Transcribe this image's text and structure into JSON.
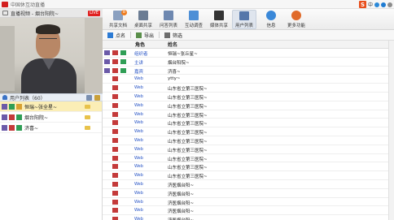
{
  "window": {
    "title": "中国休互动直播"
  },
  "ime": {
    "s_label": "S",
    "mode": "中"
  },
  "video_panel": {
    "title": "直播视频 - 烟台阳院~",
    "live_badge": "LIVE"
  },
  "toolbar": {
    "items": [
      {
        "label": "共享文档",
        "icon": "document-icon",
        "color": "#8aa0c0",
        "badge": "8"
      },
      {
        "label": "桌面共享",
        "icon": "desktop-icon",
        "color": "#6b7c93"
      },
      {
        "label": "问答列表",
        "icon": "qa-icon",
        "color": "#6e88b0"
      },
      {
        "label": "互动调查",
        "icon": "survey-icon",
        "color": "#4d8fd6"
      },
      {
        "label": "媒体共享",
        "icon": "media-icon",
        "color": "#333333"
      },
      {
        "label": "用户列表",
        "icon": "users-icon",
        "color": "#5577aa"
      },
      {
        "label": "信息",
        "icon": "info-icon",
        "color": "#3a88d8"
      },
      {
        "label": "更多功能",
        "icon": "more-icon",
        "color": "#e06a2a"
      }
    ]
  },
  "subbar": {
    "call_label": "点名",
    "export_label": "导出",
    "filter_label": "筛选"
  },
  "table": {
    "col_role": "角色",
    "col_name": "姓名",
    "rows": [
      {
        "type": "pc",
        "role": "组织者",
        "name": "恒瑞~张丘星~"
      },
      {
        "type": "pc",
        "role": "主讲",
        "name": "烟台阳院~"
      },
      {
        "type": "pc",
        "role": "嘉宾",
        "name": "济喜~"
      },
      {
        "type": "web",
        "web": "Web",
        "role": "",
        "name": "ytty~"
      },
      {
        "type": "web",
        "web": "Web",
        "role": "",
        "name": "山东省立第三医院~"
      },
      {
        "type": "web",
        "web": "Web",
        "role": "",
        "name": "山东省立第三医院~"
      },
      {
        "type": "web",
        "web": "Web",
        "role": "",
        "name": "山东省立第三医院~"
      },
      {
        "type": "web",
        "web": "Web",
        "role": "",
        "name": "山东省立第三医院~"
      },
      {
        "type": "web",
        "web": "Web",
        "role": "",
        "name": "山东省立第三医院~"
      },
      {
        "type": "web",
        "web": "Web",
        "role": "",
        "name": "山东省立第三医院~"
      },
      {
        "type": "web",
        "web": "Web",
        "role": "",
        "name": "山东省立第三医院~"
      },
      {
        "type": "web",
        "web": "Web",
        "role": "",
        "name": "山东省立第三医院~"
      },
      {
        "type": "web",
        "web": "Web",
        "role": "",
        "name": "山东省立第三医院~"
      },
      {
        "type": "web",
        "web": "Web",
        "role": "",
        "name": "山东省立第三医院~"
      },
      {
        "type": "web",
        "web": "Web",
        "role": "",
        "name": "山东省立第三医院~"
      },
      {
        "type": "web",
        "web": "Web",
        "role": "",
        "name": "济医烟台阳~"
      },
      {
        "type": "web",
        "web": "Web",
        "role": "",
        "name": "济医烟台阳~"
      },
      {
        "type": "web",
        "web": "Web",
        "role": "",
        "name": "济医烟台阳~"
      },
      {
        "type": "web",
        "web": "Web",
        "role": "",
        "name": "济医烟台阳~"
      },
      {
        "type": "web",
        "web": "Web",
        "role": "",
        "name": "济医烟台阳~"
      }
    ]
  },
  "user_list": {
    "title": "用户列表（60）",
    "users": [
      {
        "name": "恒瑞~张全星~",
        "selected": true
      },
      {
        "name": "烟台阳院~",
        "selected": false
      },
      {
        "name": "济喜~",
        "selected": false
      }
    ]
  }
}
